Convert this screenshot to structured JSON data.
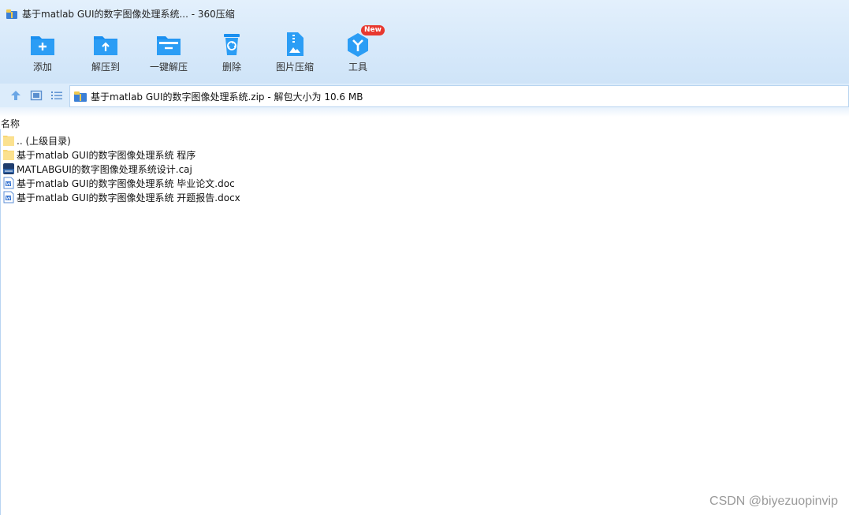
{
  "window": {
    "title": "基于matlab GUI的数字图像处理系统... - 360压缩"
  },
  "toolbar": {
    "items": [
      {
        "label": "添加",
        "icon": "add-folder-icon"
      },
      {
        "label": "解压到",
        "icon": "extract-to-icon"
      },
      {
        "label": "一键解压",
        "icon": "one-click-extract-icon"
      },
      {
        "label": "删除",
        "icon": "delete-icon"
      },
      {
        "label": "图片压缩",
        "icon": "image-compress-icon"
      },
      {
        "label": "工具",
        "icon": "tools-icon",
        "badge": "New"
      }
    ]
  },
  "navigation": {
    "address": "基于matlab GUI的数字图像处理系统.zip - 解包大小为 10.6 MB"
  },
  "file_list": {
    "column_header": "名称",
    "items": [
      {
        "name": ".. (上级目录)",
        "icon": "folder-icon"
      },
      {
        "name": "基于matlab GUI的数字图像处理系统  程序",
        "icon": "folder-icon"
      },
      {
        "name": "MATLABGUI的数字图像处理系统设计.caj",
        "icon": "caj-file-icon"
      },
      {
        "name": "基于matlab GUI的数字图像处理系统 毕业论文.doc",
        "icon": "word-doc-icon"
      },
      {
        "name": "基于matlab GUI的数字图像处理系统 开题报告.docx",
        "icon": "word-doc-icon"
      }
    ]
  },
  "watermark": "CSDN @biyezuopinvip",
  "colors": {
    "accent": "#1a8ff0",
    "folder": "#f8d775",
    "badge": "#e8382f"
  }
}
